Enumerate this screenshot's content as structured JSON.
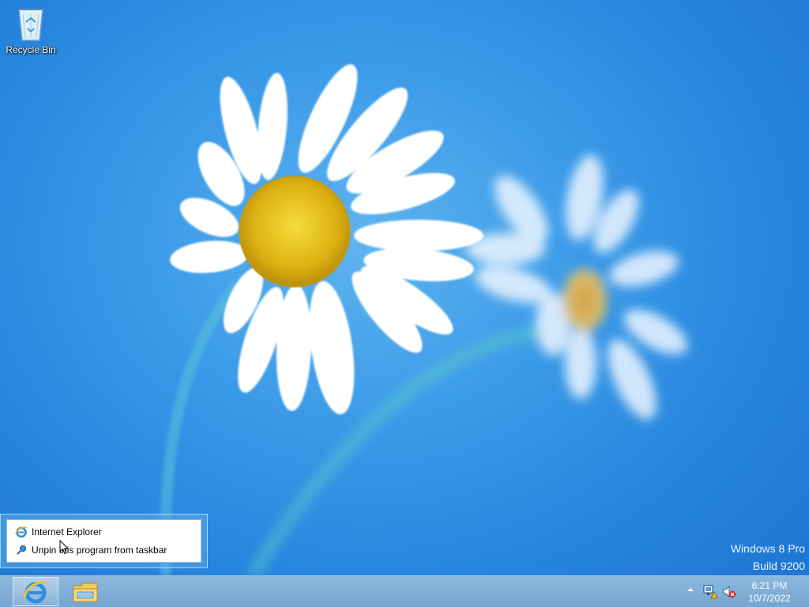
{
  "desktop": {
    "icons": [
      {
        "label": "Recycle Bin",
        "icon": "recycle-bin-icon"
      }
    ],
    "watermark": {
      "line1": "Windows 8 Pro",
      "line2": "Build 9200"
    }
  },
  "jumplist": {
    "items": [
      {
        "label": "Internet Explorer",
        "icon": "internet-explorer-icon"
      },
      {
        "label": "Unpin this program from taskbar",
        "icon": "unpin-icon"
      }
    ]
  },
  "taskbar": {
    "pinned": [
      {
        "name": "Internet Explorer",
        "icon": "internet-explorer-icon",
        "active": true
      },
      {
        "name": "File Explorer",
        "icon": "file-explorer-icon",
        "active": false
      }
    ],
    "tray": {
      "icons": [
        "show-hidden-icons-icon",
        "network-warning-icon",
        "volume-muted-icon"
      ],
      "time": "6:21 PM",
      "date": "10/7/2022"
    }
  },
  "colors": {
    "sky": "#2786df",
    "taskbar": "#7fafd7",
    "flower_center": "#e8c21a"
  }
}
